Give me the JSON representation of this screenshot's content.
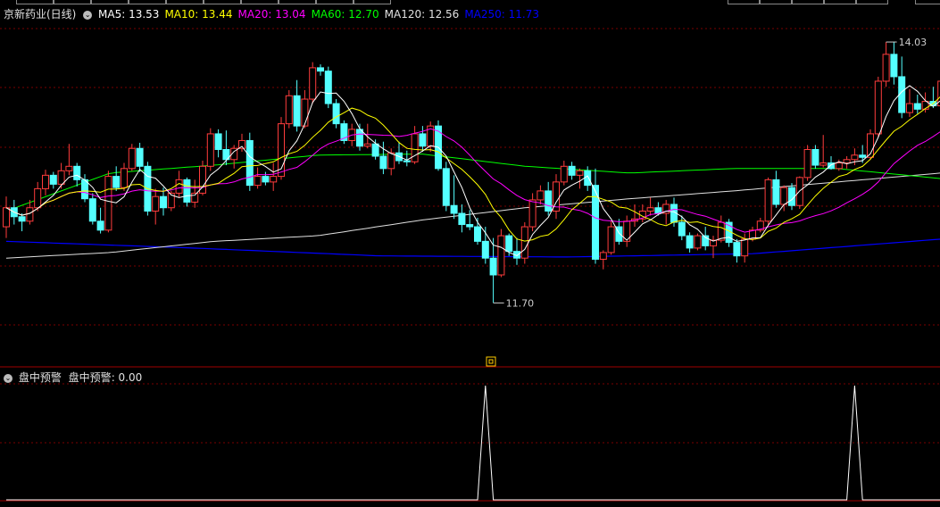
{
  "chart_data": {
    "type": "candlestick",
    "ma_lines": [
      {
        "label": "MA5",
        "value": "13.53",
        "color": "#ffffff",
        "period": 5
      },
      {
        "label": "MA10",
        "value": "13.44",
        "color": "#ffff00",
        "period": 10
      },
      {
        "label": "MA20",
        "value": "13.04",
        "color": "#ff00ff",
        "period": 20
      },
      {
        "label": "MA60",
        "value": "12.70",
        "color": "#00ff00",
        "period": 60
      },
      {
        "label": "MA120",
        "value": "12.56",
        "color": "#e0e0e0",
        "period": 120
      },
      {
        "label": "MA250",
        "value": "11.73",
        "color": "#0000ff",
        "period": 250
      }
    ],
    "high_marker": "14.03",
    "low_marker": "11.70",
    "ohlc": [
      [
        12.38,
        12.65,
        12.28,
        12.55
      ],
      [
        12.55,
        12.62,
        12.4,
        12.47
      ],
      [
        12.47,
        12.5,
        12.34,
        12.43
      ],
      [
        12.43,
        12.62,
        12.4,
        12.55
      ],
      [
        12.55,
        12.78,
        12.52,
        12.72
      ],
      [
        12.72,
        12.89,
        12.66,
        12.84
      ],
      [
        12.84,
        12.87,
        12.72,
        12.76
      ],
      [
        12.76,
        12.95,
        12.72,
        12.88
      ],
      [
        12.88,
        13.12,
        12.84,
        12.92
      ],
      [
        12.92,
        12.95,
        12.74,
        12.8
      ],
      [
        12.8,
        12.85,
        12.6,
        12.63
      ],
      [
        12.63,
        12.68,
        12.4,
        12.43
      ],
      [
        12.43,
        12.55,
        12.32,
        12.35
      ],
      [
        12.35,
        12.88,
        12.33,
        12.83
      ],
      [
        12.83,
        12.92,
        12.7,
        12.73
      ],
      [
        12.73,
        12.95,
        12.7,
        12.9
      ],
      [
        12.9,
        13.12,
        12.88,
        13.08
      ],
      [
        13.08,
        13.13,
        12.87,
        12.92
      ],
      [
        12.92,
        12.96,
        12.48,
        12.52
      ],
      [
        12.52,
        12.72,
        12.4,
        12.65
      ],
      [
        12.65,
        12.73,
        12.48,
        12.55
      ],
      [
        12.55,
        12.7,
        12.52,
        12.68
      ],
      [
        12.68,
        12.88,
        12.64,
        12.8
      ],
      [
        12.8,
        12.82,
        12.56,
        12.6
      ],
      [
        12.6,
        12.8,
        12.55,
        12.68
      ],
      [
        12.68,
        12.97,
        12.66,
        12.92
      ],
      [
        12.92,
        13.26,
        12.88,
        13.21
      ],
      [
        13.21,
        13.25,
        13.0,
        13.07
      ],
      [
        13.07,
        13.24,
        12.93,
        12.98
      ],
      [
        12.98,
        13.11,
        12.9,
        13.08
      ],
      [
        13.08,
        13.21,
        13.05,
        13.15
      ],
      [
        13.15,
        13.22,
        12.7,
        12.75
      ],
      [
        12.75,
        12.91,
        12.72,
        12.83
      ],
      [
        12.83,
        12.87,
        12.75,
        12.78
      ],
      [
        12.78,
        12.95,
        12.7,
        12.83
      ],
      [
        12.83,
        13.36,
        12.8,
        13.3
      ],
      [
        13.3,
        13.6,
        13.26,
        13.55
      ],
      [
        13.55,
        13.69,
        13.23,
        13.28
      ],
      [
        13.28,
        13.6,
        13.26,
        13.52
      ],
      [
        13.52,
        13.85,
        13.48,
        13.8
      ],
      [
        13.8,
        13.83,
        13.73,
        13.77
      ],
      [
        13.77,
        13.81,
        13.44,
        13.48
      ],
      [
        13.48,
        13.52,
        13.26,
        13.3
      ],
      [
        13.3,
        13.33,
        13.12,
        13.15
      ],
      [
        13.15,
        13.3,
        13.1,
        13.25
      ],
      [
        13.25,
        13.3,
        13.06,
        13.1
      ],
      [
        13.1,
        13.3,
        13.08,
        13.12
      ],
      [
        13.12,
        13.16,
        12.98,
        13.01
      ],
      [
        13.01,
        13.14,
        12.85,
        12.9
      ],
      [
        12.9,
        13.08,
        12.84,
        13.04
      ],
      [
        13.04,
        13.14,
        12.94,
        12.97
      ],
      [
        12.97,
        13.06,
        12.92,
        12.96
      ],
      [
        12.96,
        13.28,
        12.94,
        13.21
      ],
      [
        13.21,
        13.28,
        13.05,
        13.1
      ],
      [
        13.1,
        13.32,
        13.05,
        13.28
      ],
      [
        13.28,
        13.33,
        12.88,
        12.9
      ],
      [
        12.9,
        12.96,
        12.52,
        12.57
      ],
      [
        12.57,
        12.84,
        12.45,
        12.5
      ],
      [
        12.5,
        12.58,
        12.33,
        12.4
      ],
      [
        12.4,
        12.53,
        12.35,
        12.38
      ],
      [
        12.38,
        12.46,
        12.22,
        12.25
      ],
      [
        12.25,
        12.38,
        12.05,
        12.1
      ],
      [
        12.1,
        12.28,
        11.7,
        11.95
      ],
      [
        11.95,
        12.36,
        11.93,
        12.3
      ],
      [
        12.3,
        12.32,
        12.12,
        12.16
      ],
      [
        12.16,
        12.28,
        12.04,
        12.1
      ],
      [
        12.1,
        12.42,
        12.05,
        12.38
      ],
      [
        12.38,
        12.68,
        12.34,
        12.62
      ],
      [
        12.62,
        12.75,
        12.58,
        12.7
      ],
      [
        12.7,
        12.78,
        12.48,
        12.52
      ],
      [
        12.52,
        12.85,
        12.45,
        12.78
      ],
      [
        12.78,
        12.97,
        12.75,
        12.92
      ],
      [
        12.92,
        12.96,
        12.8,
        12.84
      ],
      [
        12.84,
        12.9,
        12.72,
        12.88
      ],
      [
        12.88,
        12.92,
        12.7,
        12.75
      ],
      [
        12.75,
        12.9,
        12.05,
        12.09
      ],
      [
        12.09,
        12.17,
        12.0,
        12.15
      ],
      [
        12.15,
        12.43,
        12.13,
        12.38
      ],
      [
        12.38,
        12.45,
        12.22,
        12.25
      ],
      [
        12.25,
        12.48,
        12.2,
        12.43
      ],
      [
        12.43,
        12.58,
        12.38,
        12.45
      ],
      [
        12.45,
        12.58,
        12.42,
        12.52
      ],
      [
        12.52,
        12.64,
        12.48,
        12.55
      ],
      [
        12.55,
        12.6,
        12.48,
        12.5
      ],
      [
        12.5,
        12.62,
        12.4,
        12.58
      ],
      [
        12.58,
        12.64,
        12.38,
        12.42
      ],
      [
        12.42,
        12.48,
        12.26,
        12.3
      ],
      [
        12.3,
        12.33,
        12.15,
        12.19
      ],
      [
        12.19,
        12.32,
        12.17,
        12.3
      ],
      [
        12.3,
        12.38,
        12.17,
        12.21
      ],
      [
        12.21,
        12.3,
        12.1,
        12.26
      ],
      [
        12.26,
        12.48,
        12.24,
        12.42
      ],
      [
        12.42,
        12.45,
        12.2,
        12.24
      ],
      [
        12.24,
        12.27,
        12.06,
        12.12
      ],
      [
        12.12,
        12.32,
        12.06,
        12.27
      ],
      [
        12.27,
        12.38,
        12.25,
        12.35
      ],
      [
        12.35,
        12.46,
        12.33,
        12.43
      ],
      [
        12.43,
        12.82,
        12.4,
        12.8
      ],
      [
        12.8,
        12.88,
        12.55,
        12.58
      ],
      [
        12.58,
        12.75,
        12.52,
        12.73
      ],
      [
        12.73,
        12.77,
        12.53,
        12.57
      ],
      [
        12.57,
        12.83,
        12.54,
        12.82
      ],
      [
        12.82,
        13.11,
        12.79,
        13.07
      ],
      [
        13.07,
        13.11,
        12.9,
        12.93
      ],
      [
        12.93,
        13.2,
        12.91,
        12.95
      ],
      [
        12.95,
        13.01,
        12.89,
        12.9
      ],
      [
        12.9,
        12.98,
        12.88,
        12.95
      ],
      [
        12.95,
        13.01,
        12.9,
        12.98
      ],
      [
        12.98,
        13.08,
        12.93,
        13.02
      ],
      [
        13.02,
        13.11,
        12.95,
        13.0
      ],
      [
        13.0,
        13.25,
        12.98,
        13.21
      ],
      [
        13.21,
        13.72,
        13.18,
        13.68
      ],
      [
        13.68,
        14.03,
        13.63,
        13.92
      ],
      [
        13.92,
        14.03,
        13.65,
        13.72
      ],
      [
        13.72,
        13.9,
        13.35,
        13.4
      ],
      [
        13.4,
        13.61,
        13.36,
        13.48
      ],
      [
        13.48,
        13.56,
        13.39,
        13.43
      ],
      [
        13.43,
        13.58,
        13.4,
        13.5
      ],
      [
        13.5,
        13.63,
        13.44,
        13.46
      ],
      [
        13.46,
        13.73,
        13.43,
        13.68
      ]
    ],
    "ma_history": {
      "ma60": [
        12.52,
        12.86,
        12.93,
        13.02,
        13.03,
        12.92,
        12.86,
        12.9,
        12.9,
        12.81
      ],
      "ma120": [
        12.1,
        12.15,
        12.25,
        12.3,
        12.44,
        12.55,
        12.63,
        12.7,
        12.78,
        12.86
      ],
      "ma250": [
        12.25,
        12.19,
        12.12,
        12.11,
        12.14,
        12.27
      ]
    },
    "signal": {
      "peaks": [
        61,
        108
      ],
      "value": "0.00"
    }
  },
  "legend": {
    "stock_name": "京新药业(日线)"
  },
  "sub": {
    "indicator_name": "盘中预警",
    "line_name": "盘中预警",
    "value_label": "0.00"
  }
}
